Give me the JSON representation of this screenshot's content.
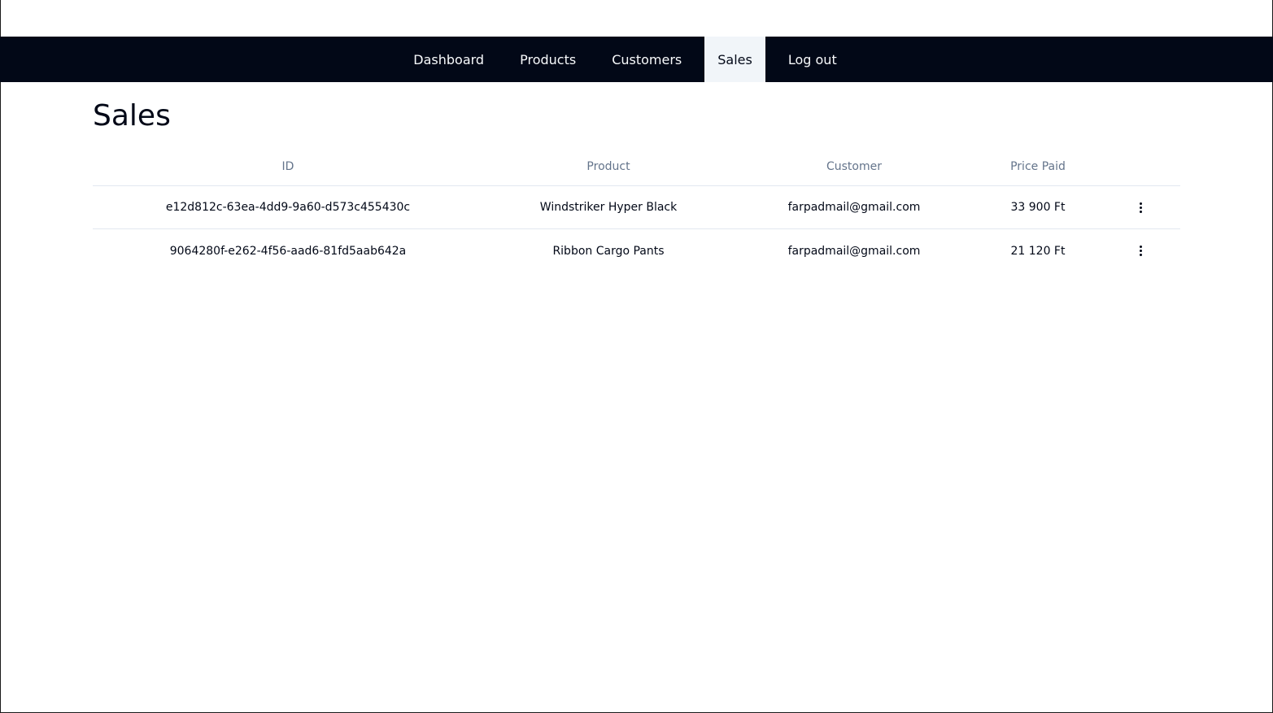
{
  "nav": {
    "items": [
      {
        "label": "Dashboard"
      },
      {
        "label": "Products"
      },
      {
        "label": "Customers"
      },
      {
        "label": "Sales",
        "active": true
      },
      {
        "label": "Log out"
      }
    ]
  },
  "page": {
    "title": "Sales"
  },
  "table": {
    "headers": [
      "ID",
      "Product",
      "Customer",
      "Price Paid"
    ],
    "rows": [
      {
        "id": "e12d812c-63ea-4dd9-9a60-d573c455430c",
        "product": "Windstriker Hyper Black",
        "customer": "farpadmail@gmail.com",
        "price": "33 900 Ft"
      },
      {
        "id": "9064280f-e262-4f56-aad6-81fd5aab642a",
        "product": "Ribbon Cargo Pants",
        "customer": "farpadmail@gmail.com",
        "price": "21 120 Ft"
      }
    ]
  },
  "icons": {
    "row_actions": "more-vertical-icon"
  }
}
